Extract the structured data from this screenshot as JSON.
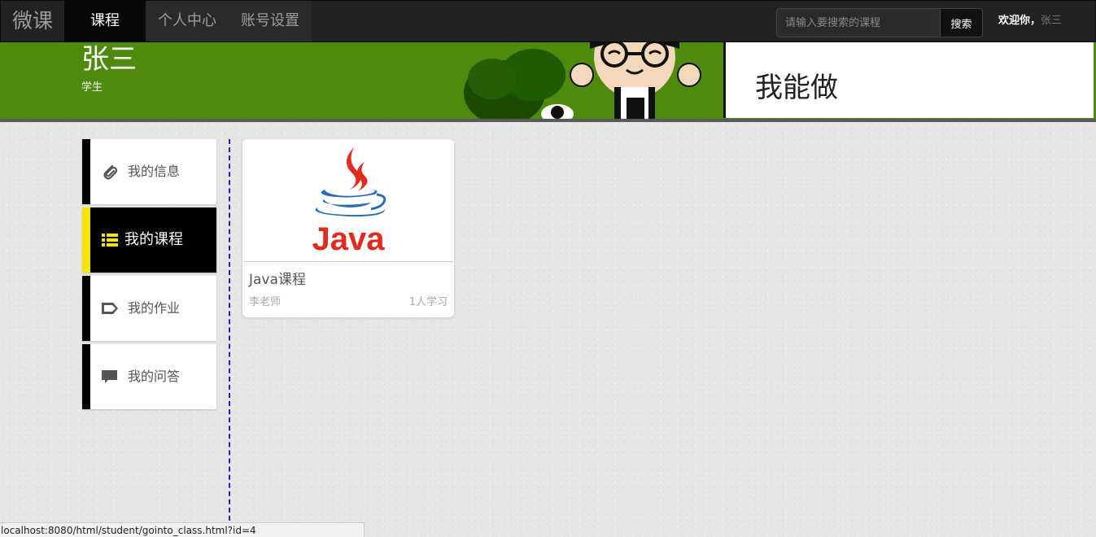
{
  "navbar": {
    "brand": "微课",
    "tabs": [
      {
        "label": "课程",
        "active": true
      },
      {
        "label": "个人中心",
        "active": false
      },
      {
        "label": "账号设置",
        "active": false
      }
    ],
    "search": {
      "placeholder": "请输入要搜索的课程",
      "button_label": "搜索"
    },
    "welcome": {
      "prefix": "欢迎你，",
      "username": "张三"
    }
  },
  "banner": {
    "name": "张三",
    "role": "学生",
    "panel_text": "我能做",
    "color": "#4e8a0b"
  },
  "sidebar": {
    "items": [
      {
        "label": "我的信息",
        "icon": "paperclip-icon",
        "active": false
      },
      {
        "label": "我的课程",
        "icon": "list-icon",
        "active": true
      },
      {
        "label": "我的作业",
        "icon": "tag-icon",
        "active": false
      },
      {
        "label": "我的问答",
        "icon": "comment-icon",
        "active": false
      }
    ],
    "active_color": "#f5e600"
  },
  "courses": [
    {
      "title": "Java课程",
      "teacher": "李老师",
      "learners": "1人学习",
      "logo_text": "Java"
    }
  ],
  "statusbar": {
    "url": "localhost:8080/html/student/gointo_class.html?id=4"
  }
}
